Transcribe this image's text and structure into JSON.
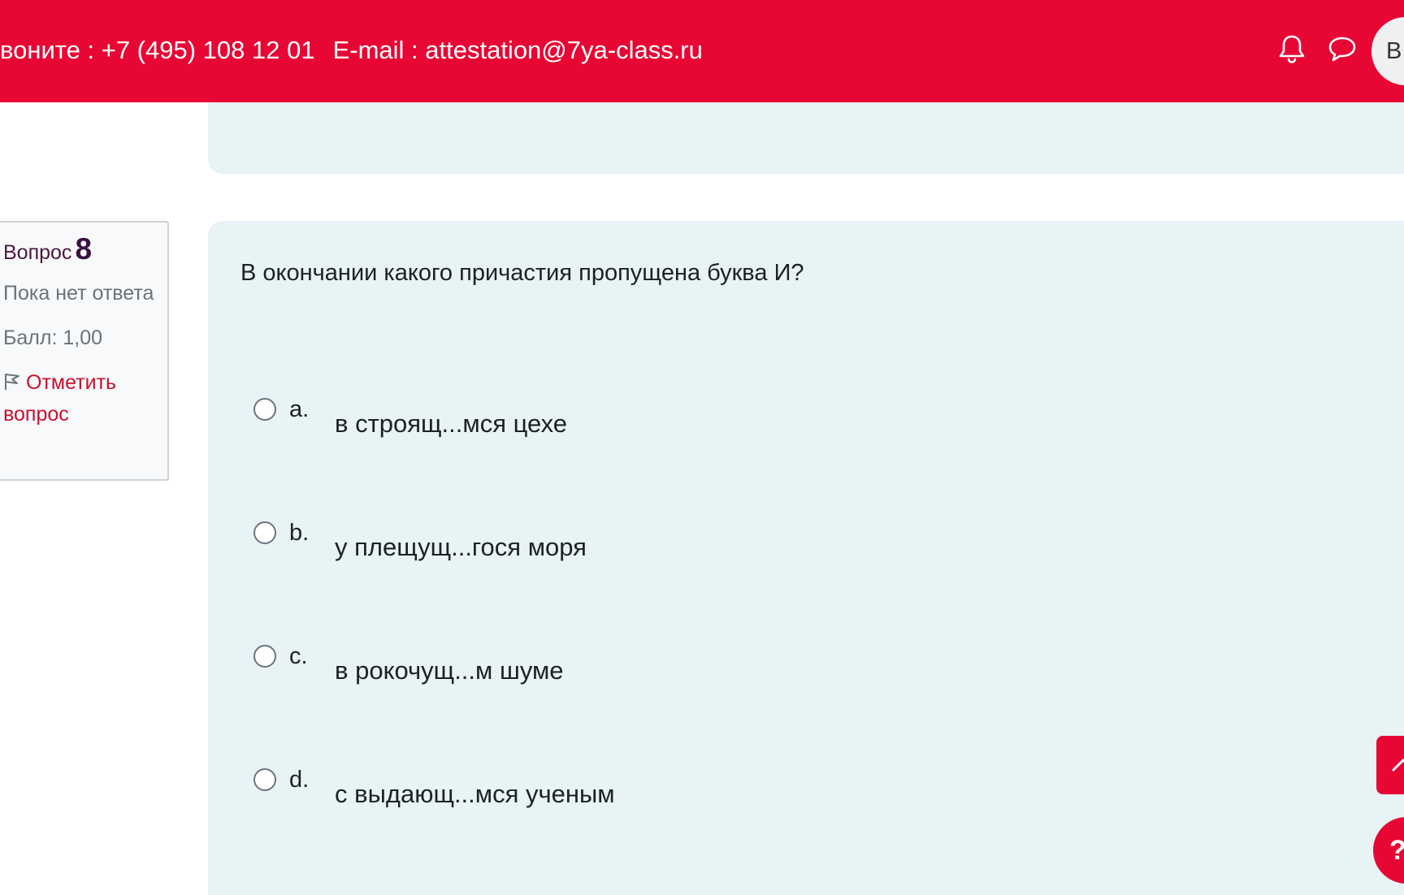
{
  "header": {
    "phone_text": "воните : +7 (495) 108 12 01",
    "email_text": "E-mail : attestation@7ya-class.ru",
    "avatar_initials": "ВІ",
    "icons": [
      "bell-icon",
      "chat-icon"
    ],
    "bar_color": "#e80734"
  },
  "question_info": {
    "label": "Вопрос",
    "number": "8",
    "state": "Пока нет ответа",
    "grade": "Балл: 1,00",
    "flag_label": "Отметить вопрос"
  },
  "question": {
    "text": "В окончании какого причастия пропущена буква И?",
    "answers": [
      {
        "letter": "a.",
        "text": "в строящ...мся цехе"
      },
      {
        "letter": "b.",
        "text": "у плещущ...гося моря"
      },
      {
        "letter": "c.",
        "text": "в рокочущ...м шуме"
      },
      {
        "letter": "d.",
        "text": "с выдающ...мся ученым"
      }
    ]
  },
  "floating": {
    "help_label": "?"
  }
}
